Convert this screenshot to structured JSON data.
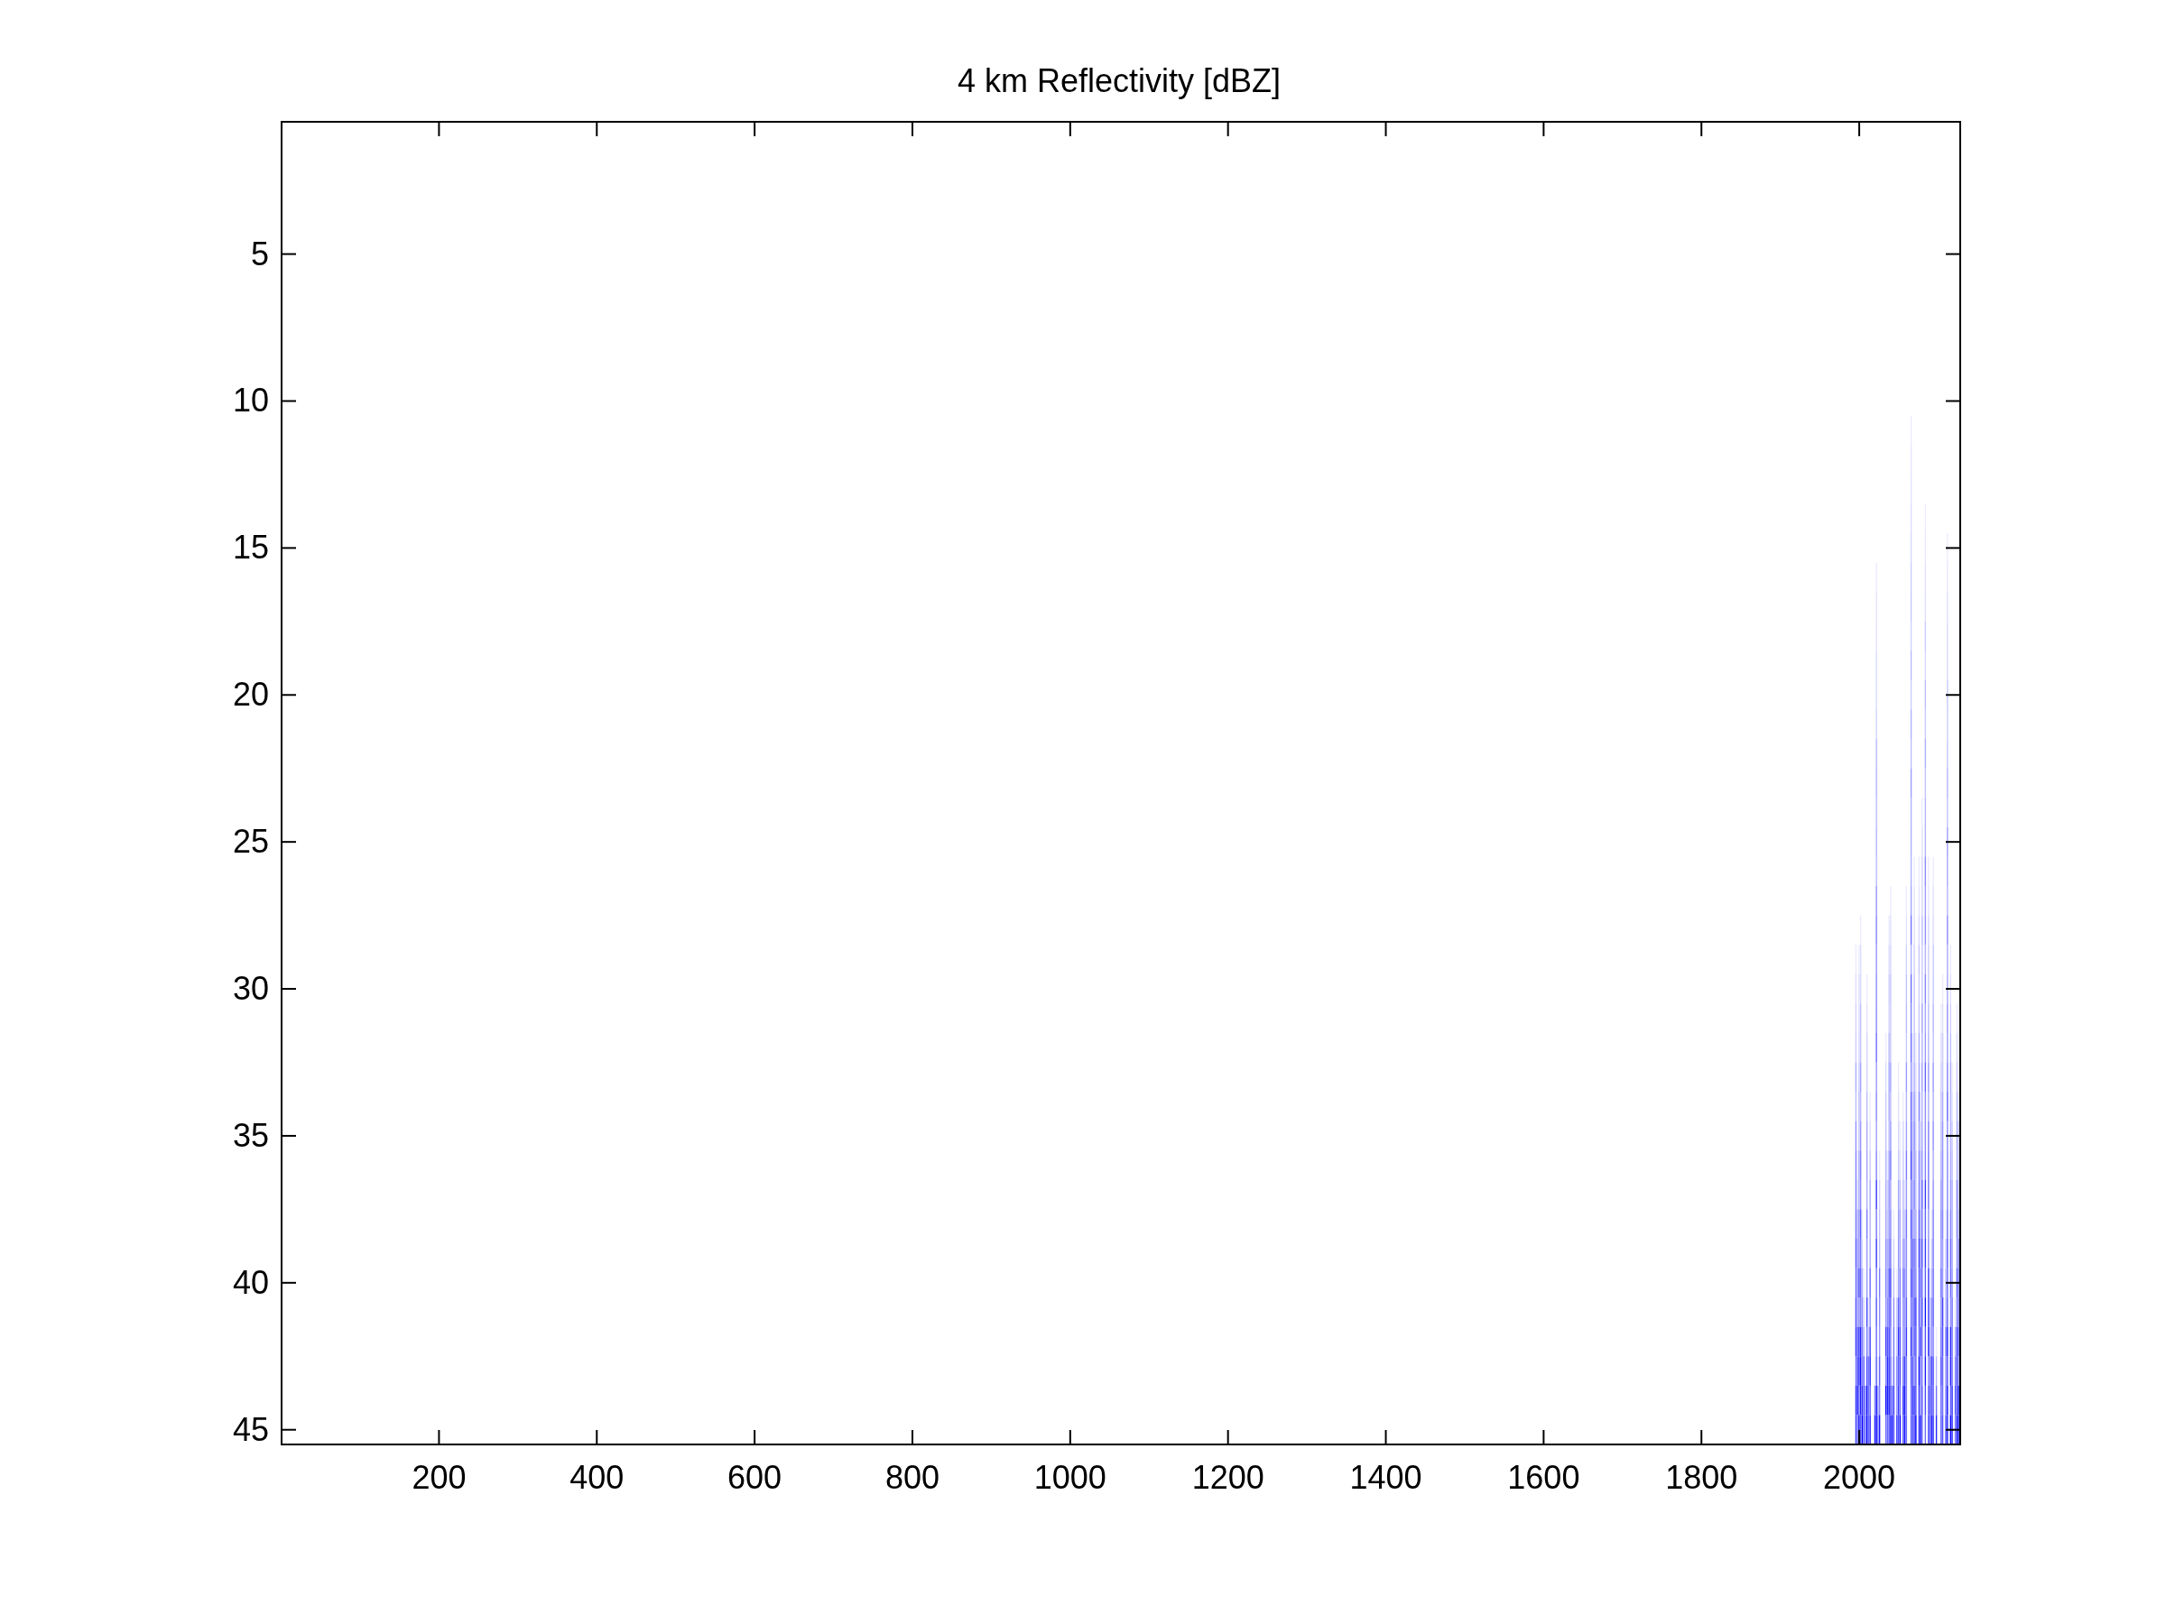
{
  "title": "4 km Reflectivity [dBZ]",
  "x_axis": {
    "ticks": [
      "200",
      "400",
      "600",
      "800",
      "1000",
      "1200",
      "1400",
      "1600",
      "1800",
      "2000"
    ]
  },
  "y_axis": {
    "ticks": [
      "5",
      "10",
      "15",
      "20",
      "25",
      "30",
      "35",
      "40",
      "45"
    ]
  }
}
